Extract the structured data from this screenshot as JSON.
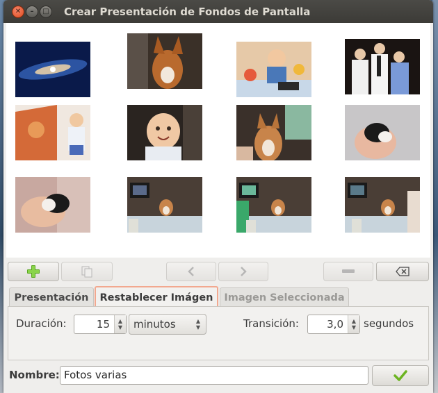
{
  "window": {
    "title": "Crear Presentación de Fondos de Pantalla"
  },
  "gallery": {
    "thumbnails": [
      {
        "name": "galaxy"
      },
      {
        "name": "dog-close-up"
      },
      {
        "name": "baby-with-toys"
      },
      {
        "name": "group-of-men"
      },
      {
        "name": "baby-in-chair"
      },
      {
        "name": "smiling-baby"
      },
      {
        "name": "dog-indoors"
      },
      {
        "name": "puppy-in-hand"
      },
      {
        "name": "puppy-held"
      },
      {
        "name": "dog-by-table-1"
      },
      {
        "name": "dog-by-table-2"
      },
      {
        "name": "dog-by-table-3"
      }
    ]
  },
  "toolbar": {
    "add_icon": "plus-icon",
    "copy_icon": "copy-icon",
    "prev_icon": "chevron-left-icon",
    "next_icon": "chevron-right-icon",
    "remove_icon": "minus-icon",
    "clear_icon": "backspace-icon"
  },
  "tabs": [
    {
      "label": "Presentación"
    },
    {
      "label": "Restablecer Imágen"
    },
    {
      "label": "Imagen Seleccionada"
    }
  ],
  "settings": {
    "duration_label": "Duración:",
    "duration_value": "15",
    "duration_unit": "minutos",
    "transition_label": "Transición:",
    "transition_value": "3,0",
    "transition_unit": "segundos"
  },
  "footer": {
    "name_label": "Nombre:",
    "name_value": "Fotos varias",
    "accept_icon": "checkmark-icon"
  },
  "colors": {
    "accent_tab_border": "#f2a88f",
    "title_bar": "#3c3b37",
    "check_green": "#6cb421"
  }
}
